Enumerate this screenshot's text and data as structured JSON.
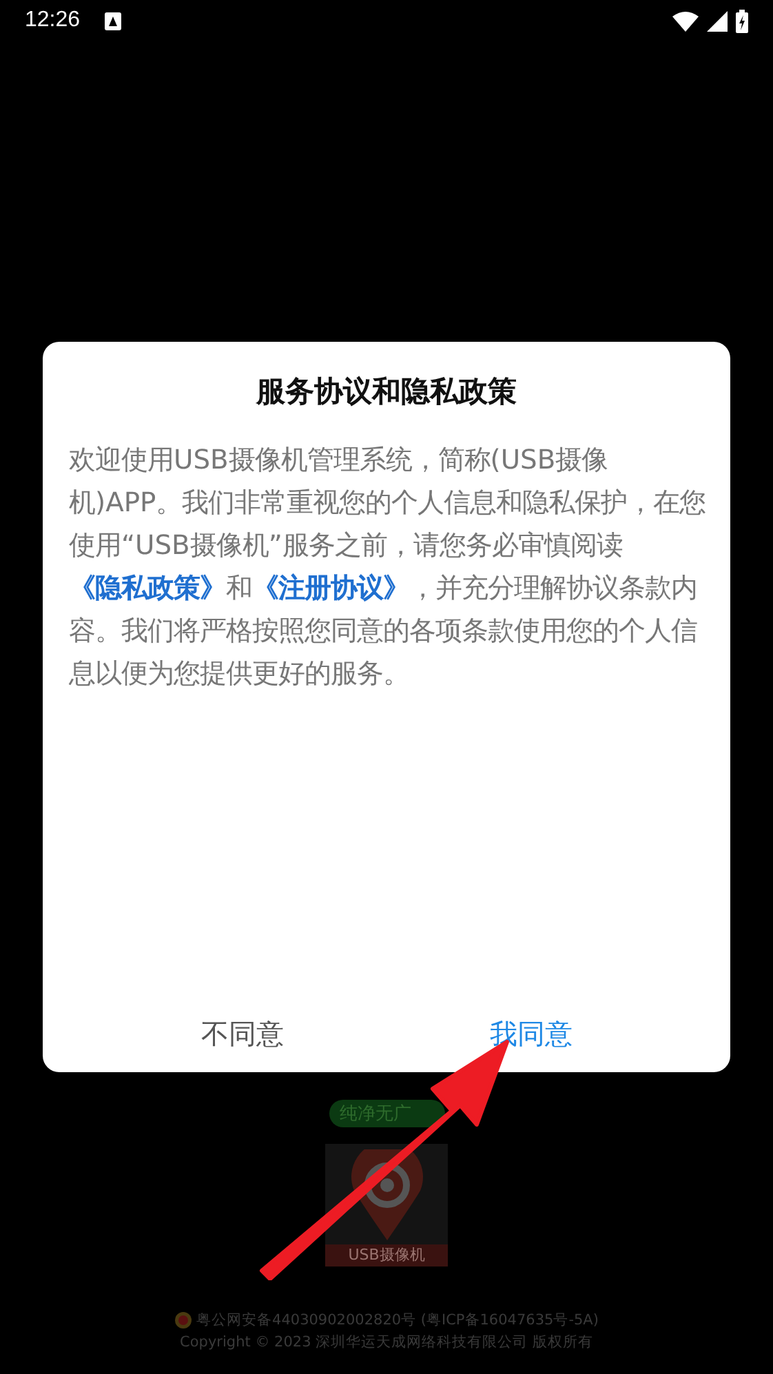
{
  "status_bar": {
    "time": "12:26"
  },
  "background": {
    "badge": "纯净无广",
    "logo_caption": "USB摄像机",
    "footer": [
      "粤公网安备44030902002820号 (粤ICP备16047635号-5A)",
      "Copyright © 2023 深圳华运天成网络科技有限公司 版权所有"
    ]
  },
  "dialog": {
    "title": "服务协议和隐私政策",
    "body": [
      {
        "kind": "text",
        "text": "欢迎使用USB摄像机管理系统，简称(USB摄像机)APP。我们非常重视您的个人信息和隐私保护，在您使用“USB摄像机”服务之前，请您务必审慎阅读"
      },
      {
        "kind": "link",
        "text": "《隐私政策》"
      },
      {
        "kind": "text",
        "text": "和"
      },
      {
        "kind": "link",
        "text": "《注册协议》"
      },
      {
        "kind": "text",
        "text": "，并充分理解协议条款内容。我们将严格按照您同意的各项条款使用您的个人信息以便为您提供更好的服务。"
      }
    ],
    "buttons": [
      {
        "label": "不同意",
        "kind": "secondary"
      },
      {
        "label": "我同意",
        "kind": "primary"
      }
    ]
  }
}
